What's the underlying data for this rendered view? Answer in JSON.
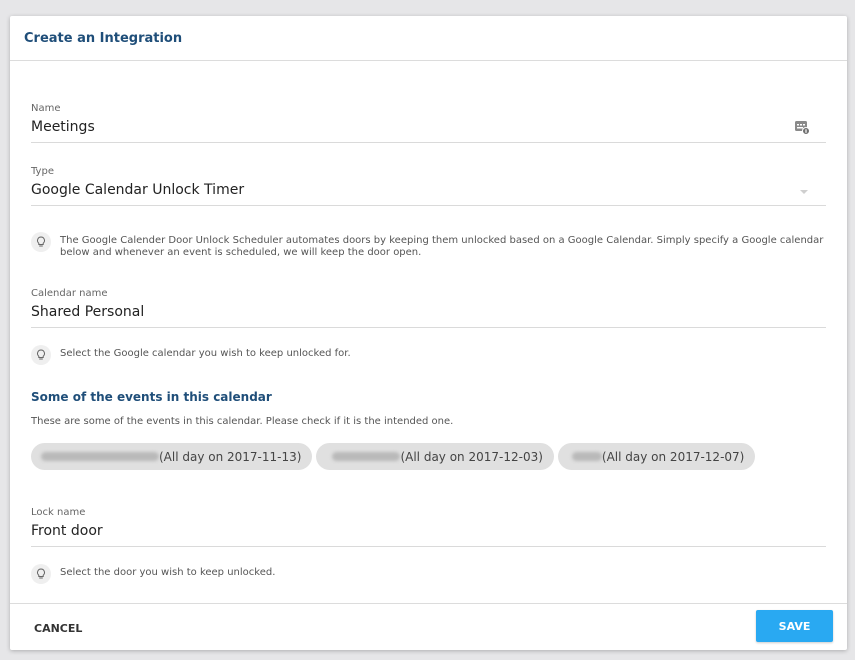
{
  "dialog": {
    "title": "Create an Integration"
  },
  "name_field": {
    "label": "Name",
    "value": "Meetings",
    "icon": "keyboard-badge-icon"
  },
  "type_field": {
    "label": "Type",
    "value": "Google Calendar Unlock Timer",
    "icon": "chevron-down-icon",
    "hint": "The Google Calender Door Unlock Scheduler automates doors by keeping them unlocked based on a Google Calendar. Simply specify a Google calendar below and whenever an event is scheduled, we will keep the door open."
  },
  "calendar_field": {
    "label": "Calendar name",
    "value": "Shared Personal",
    "hint": "Select the Google calendar you wish to keep unlocked for."
  },
  "events": {
    "title": "Some of the events in this calendar",
    "description": "These are some of the events in this calendar. Please check if it is the intended one.",
    "items": [
      {
        "label": "(All day on 2017-11-13)"
      },
      {
        "label": "(All day on 2017-12-03)"
      },
      {
        "label": "(All day on 2017-12-07)"
      }
    ]
  },
  "lock_field": {
    "label": "Lock name",
    "value": "Front door",
    "hint": "Select the door you wish to keep unlocked."
  },
  "footer": {
    "cancel_label": "CANCEL",
    "save_label": "SAVE"
  },
  "colors": {
    "accent": "#29a9f2",
    "title": "#1f4e79"
  }
}
